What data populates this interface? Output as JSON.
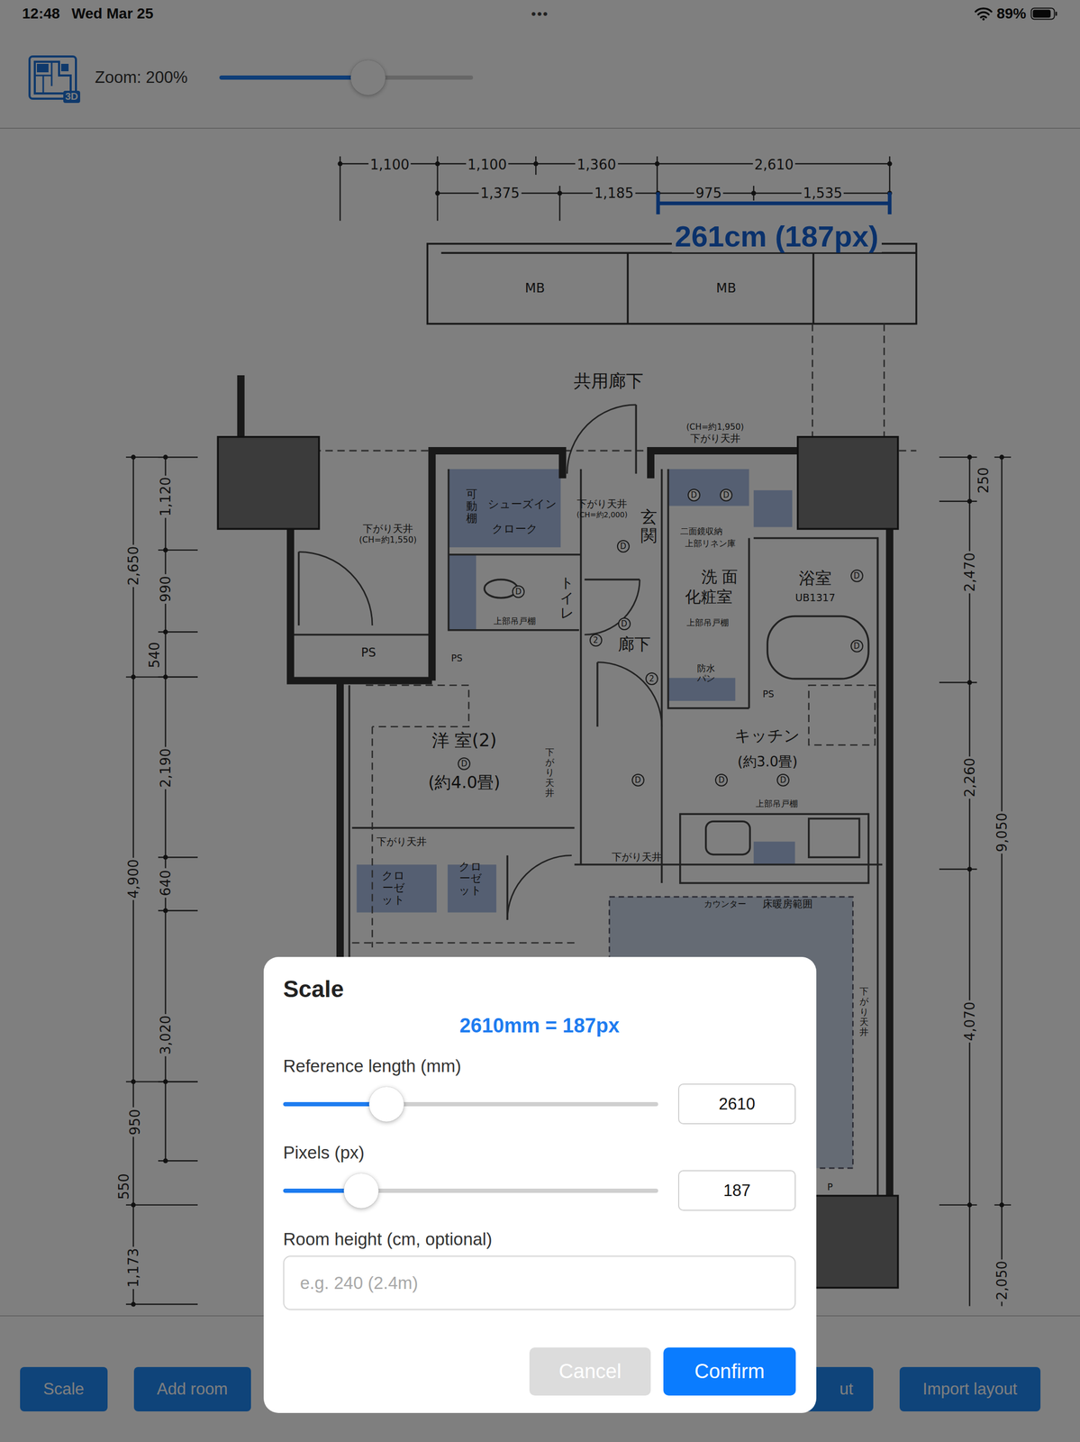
{
  "status_bar": {
    "time": "12:48",
    "date": "Wed Mar 25",
    "dots": "•••",
    "battery": "89%",
    "battery_level": 0.89
  },
  "toolbar": {
    "app_icon_badge": "3D",
    "zoom_label": "Zoom: 200%",
    "zoom_level": 0.587
  },
  "floor_plan": {
    "measurement_label": "261cm (187px)",
    "dimension_labels": [
      "1,100",
      "1,100",
      "1,360",
      "2,610",
      "1,375",
      "1,185",
      "975",
      "1,535",
      "2,650",
      "4,900",
      "550",
      "1,173",
      "1,120",
      "990",
      "540",
      "2,190",
      "640",
      "3,020",
      "950",
      "250",
      "2,470",
      "2,260",
      "4,070",
      "2,050",
      "9,050"
    ],
    "room_labels": [
      "MB",
      "MB",
      "共用廊下",
      "(CH=約1,950)",
      "下がり天井",
      "下がり天井",
      "(CH=約1,550)",
      "可動棚",
      "シューズイン",
      "クローク",
      "下がり天井",
      "(CH=約2,000)",
      "玄関",
      "二面鏡収納",
      "上部リネン庫",
      "洗 面",
      "化粧室",
      "浴室",
      "UB1317",
      "トイレ",
      "上部吊戸棚",
      "廊下",
      "上部吊戸棚",
      "防水パン",
      "PS",
      "PS",
      "PS",
      "洋 室(2)",
      "(約4.0畳)",
      "下がり天井",
      "キッチン",
      "(約3.0畳)",
      "上部吊戸棚",
      "下がり天井",
      "クローゼット",
      "クローゼット",
      "下がり天井",
      "カウンター",
      "床暖房範囲",
      "下がり天井",
      "P"
    ],
    "fixture_marks": [
      "D",
      "D",
      "D",
      "D",
      "D",
      "D",
      "D",
      "D",
      "2",
      "2",
      "D",
      "D",
      "D"
    ]
  },
  "bottom_bar": {
    "buttons": [
      {
        "label": "Scale"
      },
      {
        "label": "Add room"
      },
      {
        "label": "ut"
      },
      {
        "label": "Import layout"
      }
    ]
  },
  "dialog": {
    "title": "Scale",
    "summary": "2610mm = 187px",
    "fields": [
      {
        "label": "Reference length (mm)",
        "kind": "slider",
        "value": "2610",
        "level": 0.275
      },
      {
        "label": "Pixels (px)",
        "kind": "slider",
        "value": "187",
        "level": 0.208
      },
      {
        "label": "Room height (cm, optional)",
        "kind": "text",
        "value": "",
        "placeholder": "e.g. 240 (2.4m)"
      }
    ],
    "buttons": [
      {
        "label": "Cancel",
        "disabled": true,
        "primary": false
      },
      {
        "label": "Confirm",
        "disabled": false,
        "primary": true
      }
    ]
  }
}
